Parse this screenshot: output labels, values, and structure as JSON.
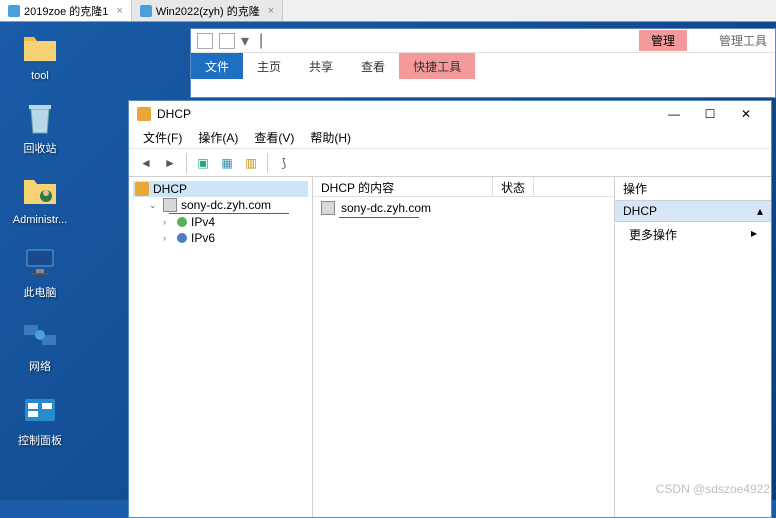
{
  "vm_tabs": [
    {
      "label": "2019zoe 的克隆1",
      "active": true
    },
    {
      "label": "Win2022(zyh) 的克隆",
      "active": false
    }
  ],
  "desktop": {
    "icons": [
      {
        "label": "tool",
        "name": "folder-tool"
      },
      {
        "label": "回收站",
        "name": "recycle-bin"
      },
      {
        "label": "Administr...",
        "name": "administrator"
      },
      {
        "label": "此电脑",
        "name": "this-pc"
      },
      {
        "label": "网络",
        "name": "network"
      },
      {
        "label": "控制面板",
        "name": "control-panel"
      }
    ]
  },
  "explorer": {
    "ribbon_groups": {
      "manage": "管理",
      "tools": "管理工具"
    },
    "tabs": {
      "file": "文件",
      "home": "主页",
      "share": "共享",
      "view": "查看",
      "quick": "快捷工具"
    }
  },
  "mmc": {
    "title": "DHCP",
    "menu": {
      "file": "文件(F)",
      "action": "操作(A)",
      "view": "查看(V)",
      "help": "帮助(H)"
    },
    "tree": {
      "root": "DHCP",
      "server": "sony-dc.zyh.com",
      "ipv4": "IPv4",
      "ipv6": "IPv6"
    },
    "content": {
      "header_col1": "DHCP 的内容",
      "header_col2": "状态",
      "rows": [
        {
          "name": "sony-dc.zyh.com"
        }
      ]
    },
    "actions": {
      "header": "操作",
      "section": "DHCP",
      "more": "更多操作"
    }
  },
  "watermark": "CSDN @sdszoe4922"
}
